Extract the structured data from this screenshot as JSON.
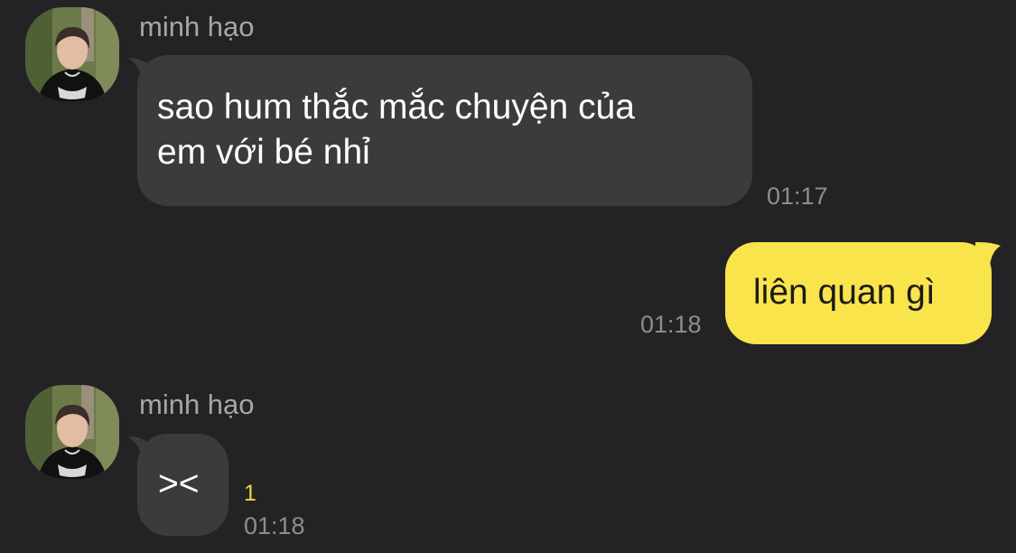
{
  "messages": [
    {
      "sender": "minh hạo",
      "text_line1": "sao hum thắc mắc chuyện của",
      "text_line2": "em với bé nhỉ",
      "time": "01:17"
    },
    {
      "text": "liên quan gì",
      "time": "01:18"
    },
    {
      "sender": "minh hạo",
      "text": "><",
      "unread_count": "1",
      "time": "01:18"
    }
  ],
  "colors": {
    "background": "#232325",
    "incoming_bubble": "#3b3b3d",
    "outgoing_bubble": "#fae44c",
    "unread_indicator": "#f2d73d"
  }
}
